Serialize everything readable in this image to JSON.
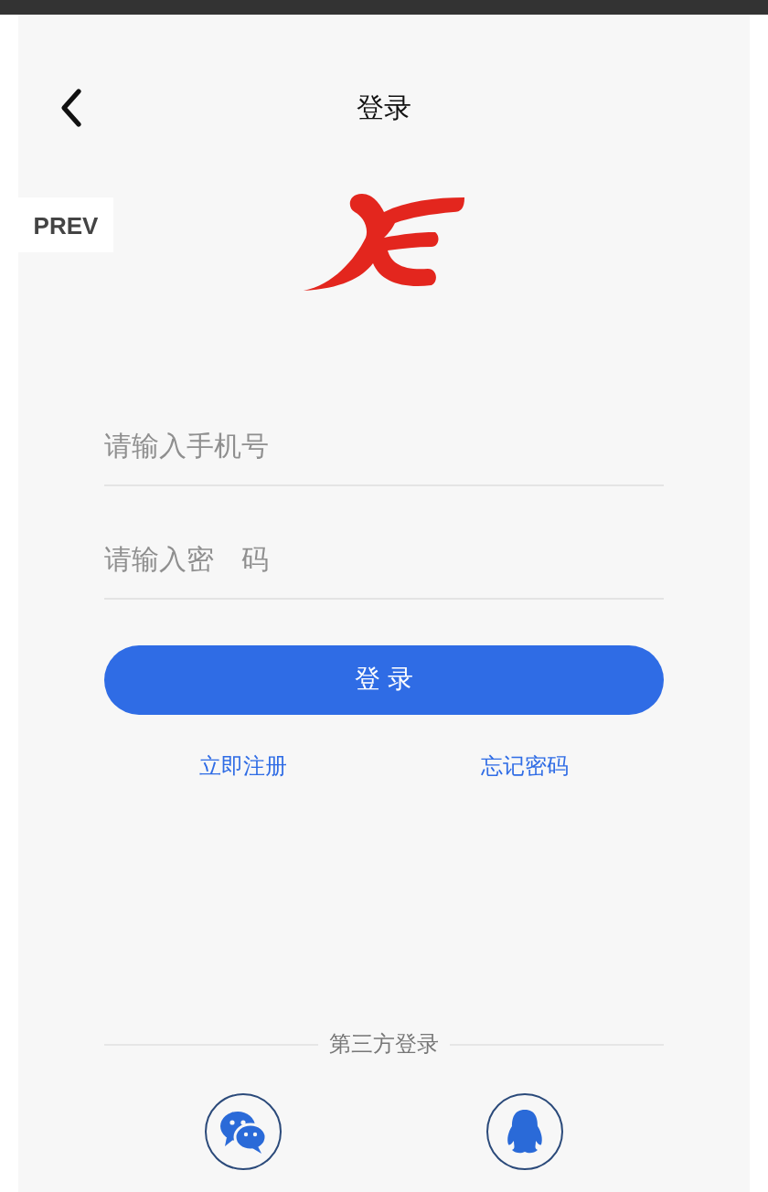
{
  "nav": {
    "title": "登录"
  },
  "prev_button": "PREV",
  "fields": [
    {
      "placeholder": "请输入手机号"
    },
    {
      "placeholder": "请输入密　码"
    }
  ],
  "login_button": "登 录",
  "links": [
    "立即注册",
    "忘记密码"
  ],
  "third_party": {
    "label": "第三方登录",
    "providers": [
      {
        "kind": "wechat"
      },
      {
        "kind": "qq"
      }
    ]
  }
}
